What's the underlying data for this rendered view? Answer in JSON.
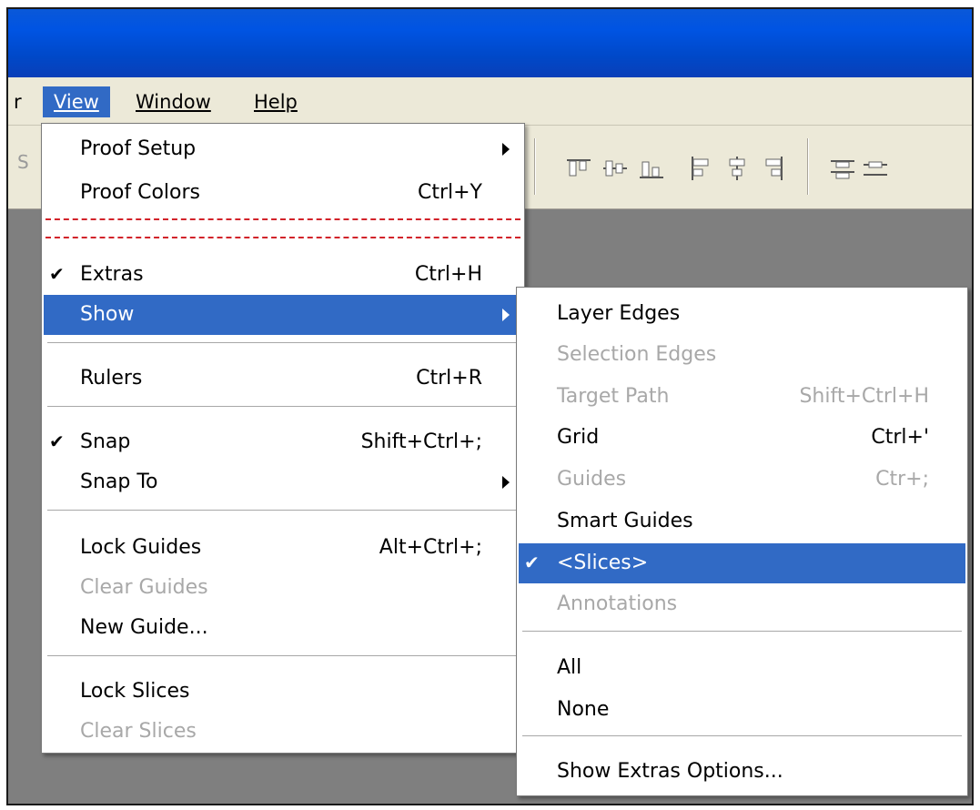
{
  "menubar": {
    "partial_left": "r",
    "view": "View",
    "window": "Window",
    "help": "Help"
  },
  "toolbar": {
    "partial_text": "S"
  },
  "view_menu": {
    "items": [
      {
        "label": "Proof Setup",
        "shortcut": "",
        "submenu": true
      },
      {
        "label": "Proof Colors",
        "shortcut": "Ctrl+Y"
      },
      {
        "label": "Extras",
        "shortcut": "Ctrl+H",
        "checked": true
      },
      {
        "label": "Show",
        "shortcut": "",
        "submenu": true,
        "highlighted": true
      },
      {
        "label": "Rulers",
        "shortcut": "Ctrl+R"
      },
      {
        "label": "Snap",
        "shortcut": "Shift+Ctrl+;",
        "checked": true
      },
      {
        "label": "Snap To",
        "shortcut": "",
        "submenu": true
      },
      {
        "label": "Lock Guides",
        "shortcut": "Alt+Ctrl+;"
      },
      {
        "label": "Clear Guides",
        "disabled": true
      },
      {
        "label": "New Guide...",
        "shortcut": ""
      },
      {
        "label": "Lock Slices",
        "shortcut": ""
      },
      {
        "label": "Clear Slices",
        "disabled": true
      }
    ],
    "check_glyph": "✔"
  },
  "show_submenu": {
    "items": [
      {
        "label": "Layer Edges"
      },
      {
        "label": "Selection Edges",
        "disabled": true
      },
      {
        "label": "Target Path",
        "shortcut": "Shift+Ctrl+H",
        "disabled": true
      },
      {
        "label": "Grid",
        "shortcut": "Ctrl+'"
      },
      {
        "label": "Guides",
        "shortcut": "Ctr+;",
        "disabled": true
      },
      {
        "label": "Smart Guides"
      },
      {
        "label": "<Slices>",
        "checked": true,
        "highlighted": true
      },
      {
        "label": "Annotations",
        "disabled": true
      },
      {
        "label": "All"
      },
      {
        "label": "None"
      },
      {
        "label": "Show Extras Options..."
      }
    ]
  },
  "colors": {
    "titlebar": "#0054e3",
    "menubar": "#ece9d8",
    "highlight": "#316ac5",
    "workspace": "#7f7f7f",
    "guide_line": "#d2232a",
    "disabled_text": "#a8a8a8"
  }
}
